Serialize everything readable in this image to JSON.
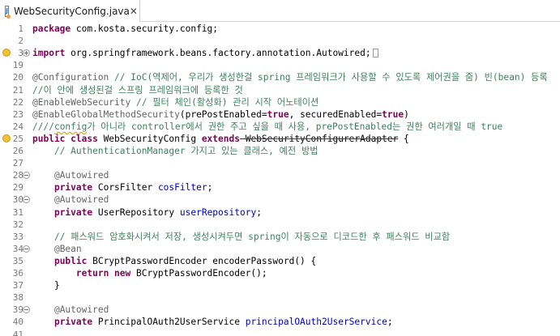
{
  "tab": {
    "title": "WebSecurityConfig.java",
    "close_glyph": "✕",
    "icon": "java-file-icon",
    "icon_letter": "J"
  },
  "colors": {
    "keyword": "#7f0055",
    "comment": "#3f7f5f",
    "annotation": "#646464",
    "field": "#0000c0",
    "warning": "#f1c232"
  },
  "lines": [
    {
      "n": "1",
      "warn": false,
      "fold": "",
      "segs": [
        [
          "kw",
          "package"
        ],
        [
          "",
          "com.kosta.security.config;"
        ]
      ]
    },
    {
      "n": "2",
      "warn": false,
      "fold": "",
      "segs": []
    },
    {
      "n": "3",
      "warn": true,
      "fold": "plus",
      "segs": [
        [
          "kw",
          "import"
        ],
        [
          "",
          "org.springframework.beans.factory.annotation.Autowired;"
        ],
        [
          "box",
          ""
        ]
      ]
    },
    {
      "n": "19",
      "warn": false,
      "fold": "",
      "segs": []
    },
    {
      "n": "20",
      "warn": false,
      "fold": "",
      "segs": [
        [
          "an",
          "@Configuration"
        ],
        [
          "cm",
          "// IoC(역제어, 우리가 생성한걸 spring 프레임워크가 사용할 수 있도록 제어권을 줌) 빈(bean) 등록"
        ]
      ]
    },
    {
      "n": "21",
      "warn": false,
      "fold": "",
      "segs": [
        [
          "cm",
          "//이 안에 생성된걸 스프링 프레임워크에 등록한 것"
        ]
      ]
    },
    {
      "n": "22",
      "warn": false,
      "fold": "",
      "segs": [
        [
          "an",
          "@EnableWebSecurity"
        ],
        [
          "cm",
          "// 필터 체인(활성화) 관리 시작 어노테이션"
        ]
      ]
    },
    {
      "n": "23",
      "warn": false,
      "fold": "",
      "segs": [
        [
          "an",
          "@EnableGlobalMethodSecurity"
        ],
        [
          "",
          "(prePostEnabled="
        ],
        [
          "kw",
          "true"
        ],
        [
          "",
          ", securedEnabled="
        ],
        [
          "kw",
          "true"
        ],
        [
          "",
          ")"
        ]
      ]
    },
    {
      "n": "24",
      "warn": false,
      "fold": "",
      "segs": [
        [
          "cm",
          "////config가 아니라 controller에서 권한 주고 싶을 때 사용, prePostEnabled는 권한 여러개일 때 true"
        ]
      ]
    },
    {
      "n": "25",
      "warn": true,
      "fold": "",
      "segs": [
        [
          "kw",
          "public class"
        ],
        [
          "",
          "WebSecurityConfig"
        ],
        [
          "kw",
          "extends"
        ],
        [
          "strike",
          "WebSecurityConfigurerAdapter"
        ],
        [
          "",
          "{"
        ]
      ]
    },
    {
      "n": "26",
      "warn": false,
      "fold": "",
      "segs": [
        [
          "",
          "    "
        ],
        [
          "cm",
          "// AuthenticationManager 가지고 있는 클래스, 예전 방법"
        ]
      ]
    },
    {
      "n": "27",
      "warn": false,
      "fold": "",
      "segs": []
    },
    {
      "n": "28",
      "warn": false,
      "fold": "minus",
      "segs": [
        [
          "",
          "    "
        ],
        [
          "an",
          "@Autowired"
        ]
      ]
    },
    {
      "n": "29",
      "warn": false,
      "fold": "",
      "segs": [
        [
          "",
          "    "
        ],
        [
          "kw",
          "private"
        ],
        [
          "",
          "CorsFilter"
        ],
        [
          "fld",
          "cosFilter"
        ],
        [
          "",
          ";"
        ]
      ]
    },
    {
      "n": "30",
      "warn": false,
      "fold": "minus",
      "segs": [
        [
          "",
          "    "
        ],
        [
          "an",
          "@Autowired"
        ]
      ]
    },
    {
      "n": "31",
      "warn": false,
      "fold": "",
      "segs": [
        [
          "",
          "    "
        ],
        [
          "kw",
          "private"
        ],
        [
          "",
          "UserRepository"
        ],
        [
          "fld",
          "userRepository"
        ],
        [
          "",
          ";"
        ]
      ]
    },
    {
      "n": "32",
      "warn": false,
      "fold": "",
      "segs": []
    },
    {
      "n": "33",
      "warn": false,
      "fold": "",
      "segs": [
        [
          "",
          "    "
        ],
        [
          "cm",
          "// 패스워드 암호화시켜서 저장, 생성시켜두면 spring이 자동으로 디코드한 후 패스워드 비교함"
        ]
      ]
    },
    {
      "n": "34",
      "warn": false,
      "fold": "minus",
      "segs": [
        [
          "",
          "    "
        ],
        [
          "an",
          "@Bean"
        ]
      ]
    },
    {
      "n": "35",
      "warn": false,
      "fold": "",
      "segs": [
        [
          "",
          "    "
        ],
        [
          "kw",
          "public"
        ],
        [
          "",
          "BCryptPasswordEncoder encoderPassword() {"
        ]
      ]
    },
    {
      "n": "36",
      "warn": false,
      "fold": "",
      "segs": [
        [
          "",
          "        "
        ],
        [
          "kw",
          "return new"
        ],
        [
          "",
          "BCryptPasswordEncoder();"
        ]
      ]
    },
    {
      "n": "37",
      "warn": false,
      "fold": "",
      "segs": [
        [
          "",
          "    }"
        ]
      ]
    },
    {
      "n": "38",
      "warn": false,
      "fold": "",
      "segs": []
    },
    {
      "n": "39",
      "warn": false,
      "fold": "minus",
      "segs": [
        [
          "",
          "    "
        ],
        [
          "an",
          "@Autowired"
        ]
      ]
    },
    {
      "n": "40",
      "warn": false,
      "fold": "",
      "segs": [
        [
          "",
          "    "
        ],
        [
          "kw",
          "private"
        ],
        [
          "",
          "PrincipalOAuth2UserService"
        ],
        [
          "fld",
          "principalOAuth2UserService"
        ],
        [
          "",
          ";"
        ]
      ]
    },
    {
      "n": "41",
      "warn": false,
      "fold": "",
      "segs": []
    }
  ]
}
